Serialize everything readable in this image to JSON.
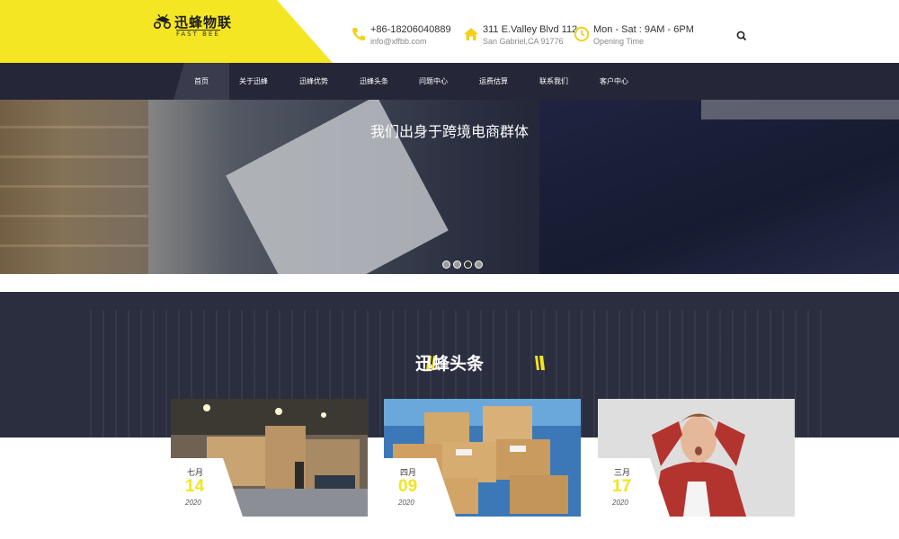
{
  "logo": {
    "name_cn": "迅蜂物联",
    "name_en": "FAST BEE"
  },
  "contact": {
    "phone": "+86-18206040889",
    "email": "info@xffbb.com",
    "address_line1": "311 E.Valley Blvd 112",
    "address_line2": "San Gabriel,CA 91776",
    "hours": "Mon - Sat : 9AM - 6PM",
    "hours_label": "Opening Time"
  },
  "nav": {
    "items": [
      {
        "label": "首页",
        "active": true
      },
      {
        "label": "关于迅蜂"
      },
      {
        "label": "迅蜂优势"
      },
      {
        "label": "迅蜂头条"
      },
      {
        "label": "问题中心"
      },
      {
        "label": "运费估算"
      },
      {
        "label": "联系我们"
      },
      {
        "label": "客户中心"
      }
    ]
  },
  "hero": {
    "title": "我们出身于跨境电商群体",
    "slide_count": 4,
    "active_slide": 3
  },
  "news": {
    "heading": "迅蜂头条",
    "cards": [
      {
        "month": "七月",
        "day": "14",
        "year": "2020"
      },
      {
        "month": "四月",
        "day": "09",
        "year": "2020"
      },
      {
        "month": "三月",
        "day": "17",
        "year": "2020"
      }
    ]
  },
  "colors": {
    "accent_yellow": "#f5e623",
    "nav_bg": "#252637",
    "date_yellow": "#f3e41e",
    "section_dark": "#2b2e3f"
  },
  "icons": {
    "phone": "phone-icon",
    "address": "home-icon",
    "hours": "clock-icon",
    "search": "search-icon"
  }
}
